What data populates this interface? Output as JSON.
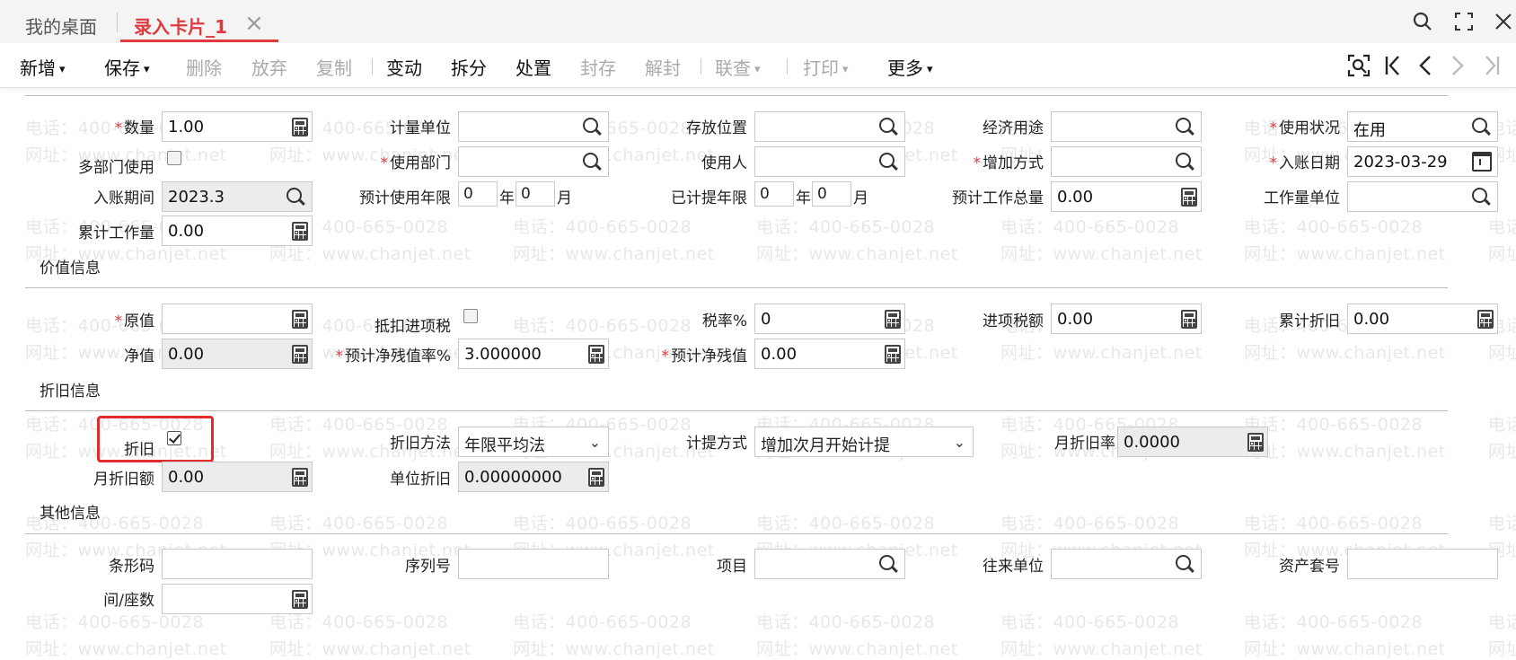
{
  "tabs": {
    "home": "我的桌面",
    "active": "录入卡片_1",
    "close": "×"
  },
  "toolbar": {
    "add": "新增",
    "save": "保存",
    "delete": "删除",
    "discard": "放弃",
    "copy": "复制",
    "change": "变动",
    "split": "拆分",
    "dispose": "处置",
    "seal": "封存",
    "unseal": "解封",
    "query": "联查",
    "print": "打印",
    "more": "更多"
  },
  "watermark": {
    "phone": "电话：400-665-0028",
    "site": "网址：www.chanjet.net"
  },
  "basic": {
    "quantity_label": "数量",
    "quantity_value": "1.00",
    "unit_label": "计量单位",
    "unit_value": "",
    "location_label": "存放位置",
    "location_value": "",
    "econ_use_label": "经济用途",
    "econ_use_value": "",
    "status_label": "使用状况",
    "status_value": "在用",
    "multi_dept_label": "多部门使用",
    "dept_label": "使用部门",
    "dept_value": "",
    "user_label": "使用人",
    "user_value": "",
    "add_method_label": "增加方式",
    "add_method_value": "",
    "entry_date_label": "入账日期",
    "entry_date_value": "2023-03-29",
    "entry_period_label": "入账期间",
    "entry_period_value": "2023.3",
    "est_life_label": "预计使用年限",
    "est_life_year": "0",
    "est_life_month": "0",
    "accrued_life_label": "已计提年限",
    "accrued_life_year": "0",
    "accrued_life_month": "0",
    "year_unit": "年",
    "month_unit": "月",
    "est_workload_label": "预计工作总量",
    "est_workload_value": "0.00",
    "workload_unit_label": "工作量单位",
    "workload_unit_value": "",
    "acc_workload_label": "累计工作量",
    "acc_workload_value": "0.00"
  },
  "value_section": {
    "title": "价值信息",
    "original_label": "原值",
    "original_value": "",
    "deduct_tax_label": "抵扣进项税",
    "tax_rate_label": "税率%",
    "tax_rate_value": "0",
    "input_tax_label": "进项税额",
    "input_tax_value": "0.00",
    "acc_dep_label": "累计折旧",
    "acc_dep_value": "0.00",
    "net_label": "净值",
    "net_value": "0.00",
    "residual_rate_label": "预计净残值率%",
    "residual_rate_value": "3.000000",
    "residual_label": "预计净残值",
    "residual_value": "0.00"
  },
  "dep_section": {
    "title": "折旧信息",
    "dep_label": "折旧",
    "method_label": "折旧方法",
    "method_value": "年限平均法",
    "accrual_label": "计提方式",
    "accrual_value": "增加次月开始计提",
    "monthly_rate_label": "月折旧率",
    "monthly_rate_value": "0.0000",
    "monthly_amount_label": "月折旧额",
    "monthly_amount_value": "0.00",
    "unit_dep_label": "单位折旧",
    "unit_dep_value": "0.00000000"
  },
  "other_section": {
    "title": "其他信息",
    "barcode_label": "条形码",
    "barcode_value": "",
    "serial_label": "序列号",
    "serial_value": "",
    "project_label": "项目",
    "project_value": "",
    "partner_label": "往来单位",
    "partner_value": "",
    "asset_set_label": "资产套号",
    "asset_set_value": "",
    "room_label": "间/座数",
    "room_value": ""
  }
}
